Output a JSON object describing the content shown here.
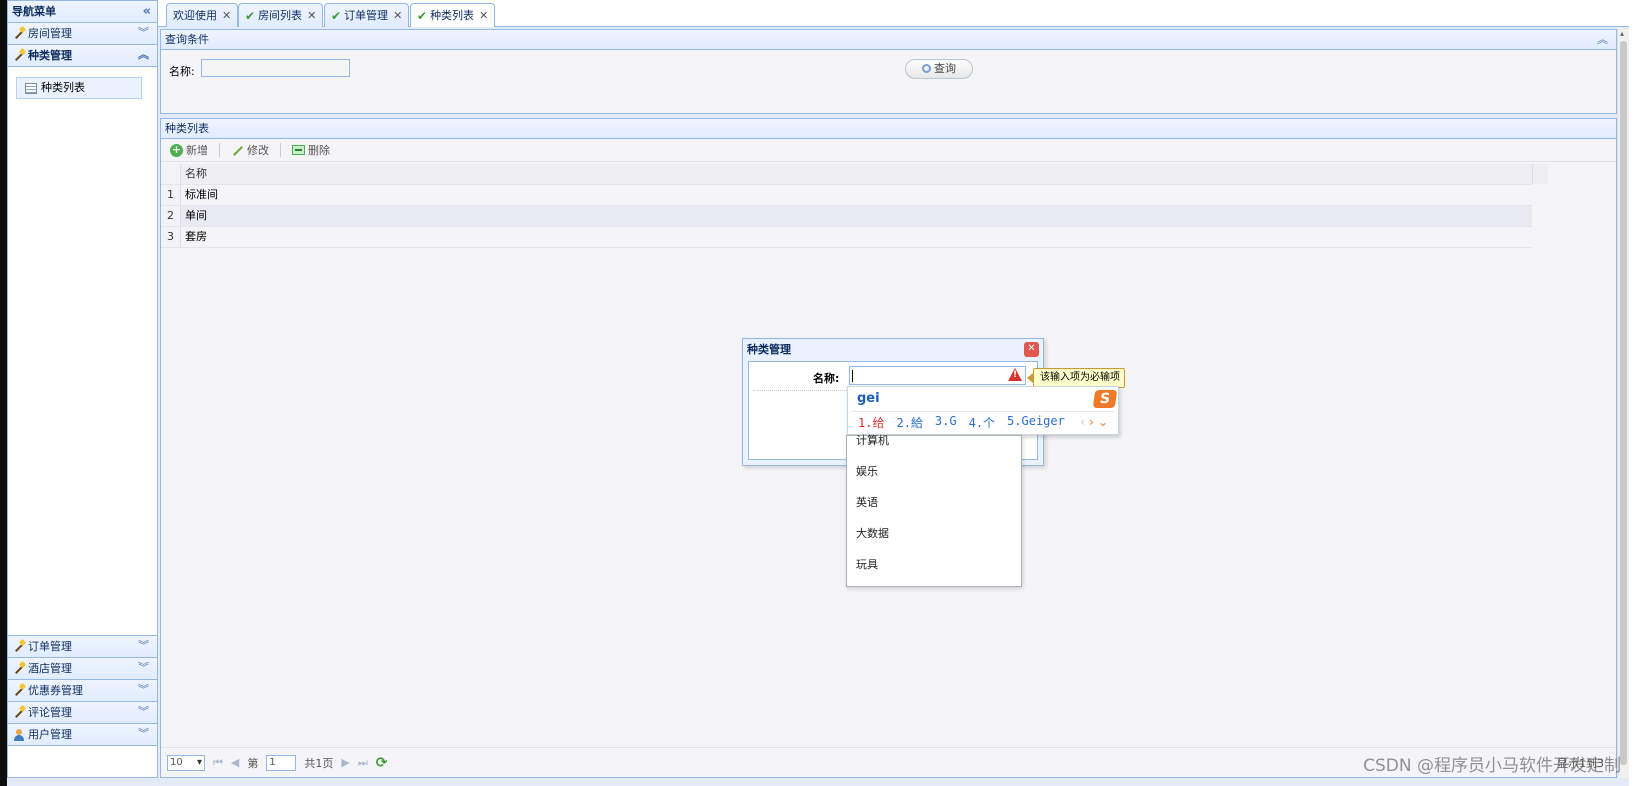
{
  "sidebar": {
    "title": "导航菜单",
    "collapse_icon": "double-chevron-left-icon",
    "sections_top": [
      {
        "label": "房间管理",
        "expanded": false
      },
      {
        "label": "种类管理",
        "expanded": true
      }
    ],
    "active_item": "种类列表",
    "sections_bottom": [
      {
        "label": "订单管理"
      },
      {
        "label": "酒店管理"
      },
      {
        "label": "优惠券管理"
      },
      {
        "label": "评论管理"
      },
      {
        "label": "用户管理"
      }
    ]
  },
  "tabs": [
    {
      "label": "欢迎使用",
      "checked": false
    },
    {
      "label": "房间列表",
      "checked": true
    },
    {
      "label": "订单管理",
      "checked": true
    },
    {
      "label": "种类列表",
      "checked": true,
      "selected": true
    }
  ],
  "query_panel": {
    "title": "查询条件",
    "name_label": "名称:",
    "name_value": "",
    "search_button": "查询"
  },
  "list_panel": {
    "title": "种类列表",
    "toolbar": {
      "add": "新增",
      "edit": "修改",
      "delete": "删除"
    },
    "columns": [
      "名称"
    ],
    "rows": [
      {
        "num": "1",
        "name": "标准间"
      },
      {
        "num": "2",
        "name": "单间"
      },
      {
        "num": "3",
        "name": "套房"
      }
    ],
    "pager": {
      "page_size": "10",
      "page_prefix": "第",
      "page_value": "1",
      "total_pages": "共1页",
      "info": "显示1到3"
    }
  },
  "dialog": {
    "title": "种类管理",
    "name_label": "名称:",
    "validation_tooltip": "该输入项为必输项"
  },
  "ime": {
    "composition": "gei",
    "candidates": [
      "1.给",
      "2.給",
      "3.G",
      "4.个",
      "5.Geiger"
    ],
    "logo": "S"
  },
  "autocomplete_options": [
    "计算机",
    "娱乐",
    "英语",
    "大数据",
    "玩具"
  ],
  "watermark": "CSDN @程序员小马软件开发定制"
}
